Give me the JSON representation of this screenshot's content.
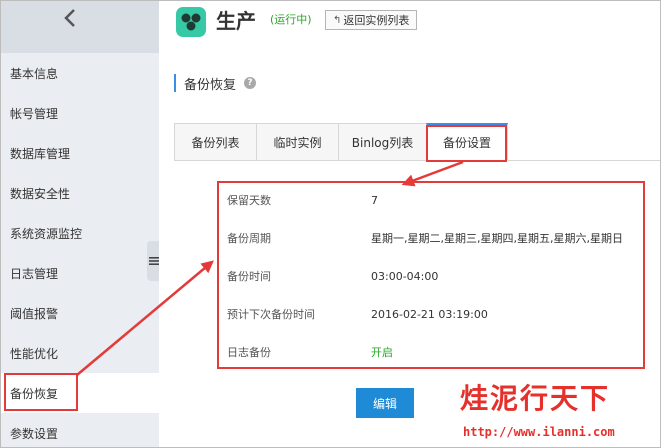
{
  "sidebar": {
    "items": [
      {
        "label": "基本信息"
      },
      {
        "label": "帐号管理"
      },
      {
        "label": "数据库管理"
      },
      {
        "label": "数据安全性"
      },
      {
        "label": "系统资源监控"
      },
      {
        "label": "日志管理"
      },
      {
        "label": "阈值报警"
      },
      {
        "label": "性能优化"
      },
      {
        "label": "备份恢复"
      },
      {
        "label": "参数设置"
      }
    ],
    "active_index": 8
  },
  "header": {
    "title": "生产",
    "status": "(运行中)",
    "back_button": "返回实例列表",
    "back_icon": "↰"
  },
  "section": {
    "title": "备份恢复",
    "help_icon": "?"
  },
  "tabs": [
    {
      "label": "备份列表"
    },
    {
      "label": "临时实例"
    },
    {
      "label": "Binlog列表"
    },
    {
      "label": "备份设置"
    }
  ],
  "settings": [
    {
      "key": "保留天数",
      "value": "7"
    },
    {
      "key": "备份周期",
      "value": "星期一,星期二,星期三,星期四,星期五,星期六,星期日"
    },
    {
      "key": "备份时间",
      "value": "03:00-04:00"
    },
    {
      "key": "预计下次备份时间",
      "value": "2016-02-21 03:19:00"
    },
    {
      "key": "日志备份",
      "value": "开启"
    }
  ],
  "edit_button": "编辑",
  "watermark": {
    "text": "烓泥行天下",
    "url": "http://www.ilanni.com"
  },
  "colors": {
    "accent": "#1f8bd6",
    "annotation": "#e53a3a",
    "status_green": "#2aa52a",
    "logo": "#37c9a5"
  }
}
